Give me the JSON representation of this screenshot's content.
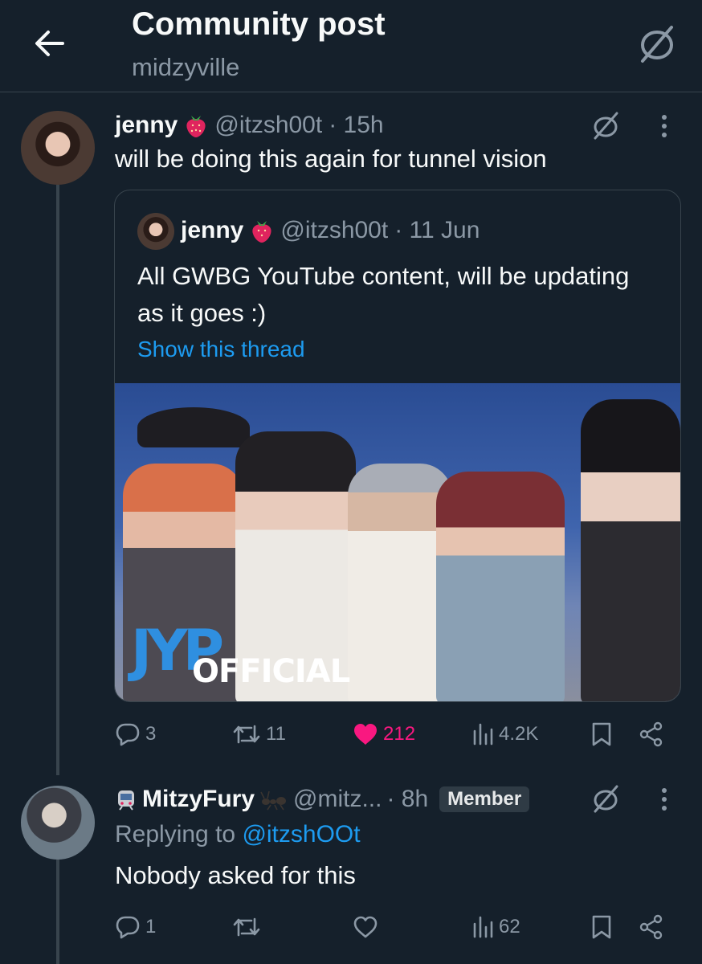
{
  "header": {
    "title": "Community post",
    "community": "midzyville"
  },
  "tweet": {
    "name": "jenny",
    "handle": "@itzsh00t",
    "time": "· 15h",
    "body": "will be doing this again for tunnel vision",
    "quote": {
      "name": "jenny",
      "handle": "@itzsh00t",
      "time": "· 11 Jun",
      "body": "All GWBG YouTube content, will be updating as it goes :)",
      "show_thread": "Show this thread",
      "image_logo": "JYP",
      "image_caption": "OFFICIAL"
    },
    "actions": {
      "replies": "3",
      "retweets": "11",
      "likes": "212",
      "views": "4.2K"
    }
  },
  "reply": {
    "name": "MitzyFury",
    "handle": "@mitz...",
    "time": "· 8h",
    "badge": "Member",
    "replying_label": "Replying to",
    "replying_handle": "@itzshOOt",
    "body": "Nobody asked for this",
    "actions": {
      "replies": "1",
      "retweets": "",
      "likes": "",
      "views": "62"
    }
  },
  "colors": {
    "background": "#15202b",
    "accent": "#1d9bf0",
    "like": "#f91880",
    "muted": "#8b98a5"
  },
  "icons": [
    "back-arrow-icon",
    "slash-circle-icon",
    "more-icon",
    "strawberry-icon",
    "reply-icon",
    "retweet-icon",
    "heart-icon",
    "views-icon",
    "bookmark-icon",
    "share-icon",
    "tram-icon",
    "ant-icon"
  ]
}
